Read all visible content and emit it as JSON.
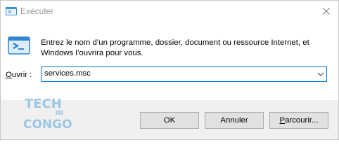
{
  "window": {
    "title": "Exécuter",
    "close_glyph": "✕"
  },
  "description": "Entrez le nom d’un programme, dossier, document ou ressource Internet, et Windows l’ouvrira pour vous.",
  "open_field": {
    "label_accel": "O",
    "label_rest": "uvrir :",
    "value": "services.msc"
  },
  "buttons": {
    "ok": "OK",
    "cancel": "Annuler",
    "browse_accel": "P",
    "browse_rest": "arcourir..."
  },
  "watermark": {
    "line1": "TECH",
    "line2": "IN",
    "line3": "CONGO"
  },
  "colors": {
    "accent": "#0078d7",
    "footer_bg": "#f0f0f0",
    "button_bg": "#e1e1e1",
    "watermark": "#7fb8e0"
  }
}
